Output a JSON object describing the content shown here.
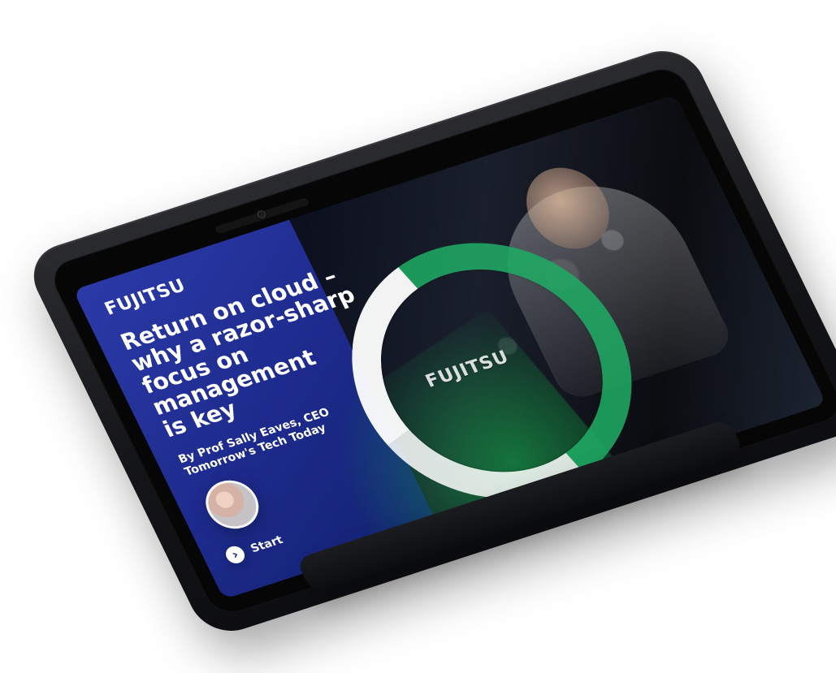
{
  "screen": {
    "brand": "FUJITSU",
    "headline": "Return on cloud –\nwhy a razor-sharp\nfocus on management\nis key",
    "byline": "By Prof Sally Eaves, CEO\nTomorrow's Tech Today",
    "start_label": "Start",
    "start_icon": "chevron-right-icon"
  },
  "device": {
    "logo": "FUJITSU"
  },
  "colors": {
    "panel_blue_1": "#2b3aa8",
    "panel_blue_2": "#10216a",
    "accent_green": "#20aa64",
    "text_white": "#ffffff"
  }
}
